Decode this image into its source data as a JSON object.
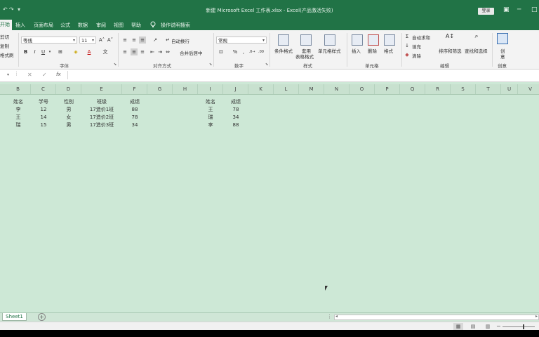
{
  "window": {
    "title": "新建 Microsoft Excel 工作表.xlsx  -  Excel(产品激活失败)",
    "login_label": "登录"
  },
  "tabs": [
    "开始",
    "插入",
    "页面布局",
    "公式",
    "数据",
    "审阅",
    "视图",
    "帮助"
  ],
  "tell_me": "操作说明搜索",
  "ribbon": {
    "clipboard": {
      "cut": "剪切",
      "copy": "复制",
      "format_painter": "格式刷"
    },
    "font": {
      "name": "等线",
      "size": "11",
      "group_label": "字体",
      "grow": "A˄",
      "shrink": "A˅",
      "bold": "B",
      "italic": "I",
      "underline": "U",
      "font_color_glyph": "A",
      "wen": "文"
    },
    "alignment": {
      "wrap": "自动换行",
      "merge": "合并后居中",
      "group_label": "对齐方式"
    },
    "number": {
      "format": "常规",
      "group_label": "数字",
      "percent": "%",
      "comma": ","
    },
    "styles": {
      "conditional": "条件格式",
      "table_line1": "套用",
      "table_line2": "表格格式",
      "cell_styles": "单元格样式",
      "group_label": "样式"
    },
    "cells": {
      "insert": "插入",
      "delete": "删除",
      "format": "格式",
      "group_label": "单元格"
    },
    "editing": {
      "autosum": "自动求和",
      "fill": "填充",
      "clear": "清除",
      "sort": "排序和筛选",
      "find": "查找和选择",
      "group_label": "编辑"
    },
    "ideas": {
      "line1": "创",
      "line2": "意",
      "group_label": "创意"
    }
  },
  "formula_bar": {
    "cancel": "✕",
    "enter": "✓",
    "fx": "fx"
  },
  "columns": [
    "B",
    "C",
    "D",
    "E",
    "F",
    "G",
    "H",
    "I",
    "J",
    "K",
    "L",
    "M",
    "N",
    "O",
    "P",
    "Q",
    "R",
    "S",
    "T",
    "U",
    "V"
  ],
  "table1": {
    "headers": [
      "姓名",
      "学号",
      "性别",
      "班级",
      "成绩"
    ],
    "rows": [
      [
        "李",
        "12",
        "男",
        "17造价1班",
        "88"
      ],
      [
        "王",
        "14",
        "女",
        "17造价2班",
        "78"
      ],
      [
        "瑞",
        "15",
        "男",
        "17造价3班",
        "34"
      ]
    ]
  },
  "table2": {
    "headers": [
      "姓名",
      "成绩"
    ],
    "rows": [
      [
        "王",
        "78"
      ],
      [
        "瑞",
        "34"
      ],
      [
        "李",
        "88"
      ]
    ]
  },
  "sheet_tab": "Sheet1",
  "colors": {
    "excel_green": "#217346",
    "sheet_bg": "#cde8d6"
  }
}
